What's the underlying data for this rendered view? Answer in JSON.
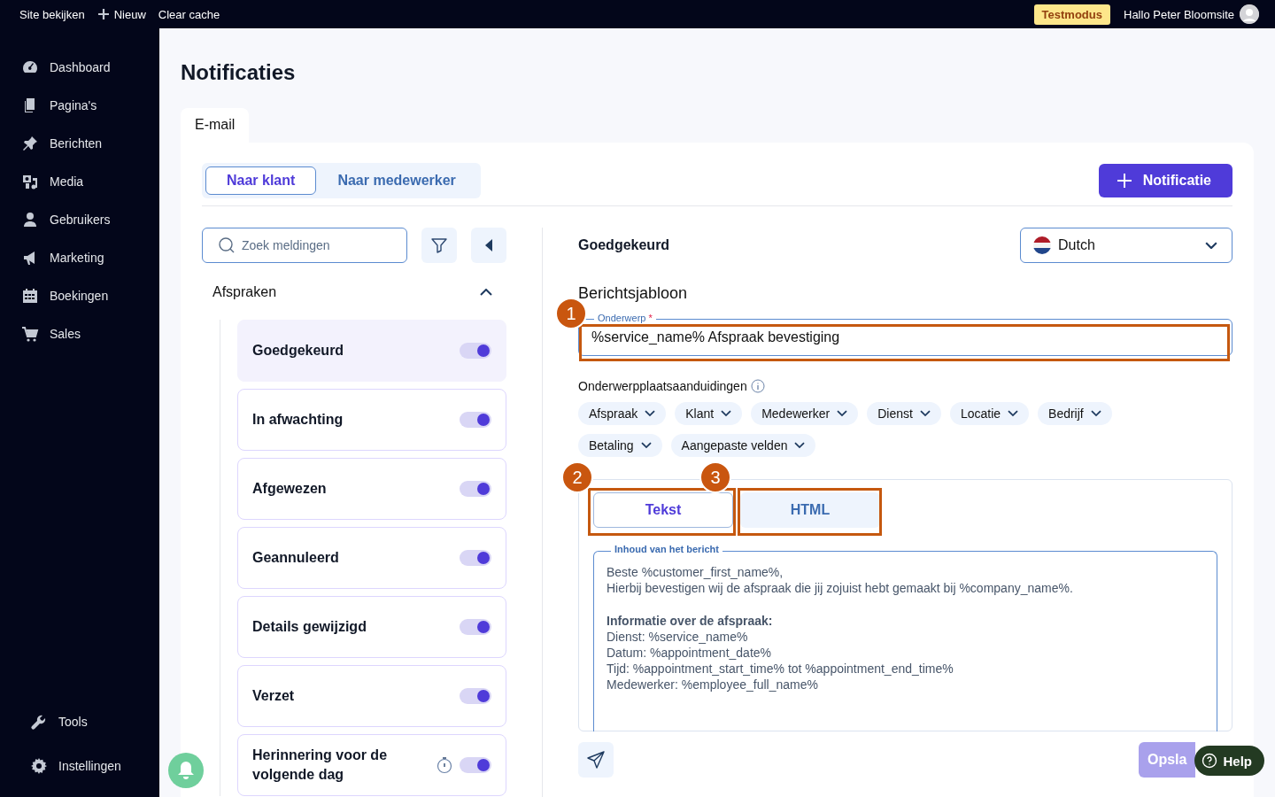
{
  "topbar": {
    "links": [
      "Site bekijken",
      "Nieuw",
      "Clear cache"
    ],
    "badge": "Testmodus",
    "greeting": "Hallo Peter Bloomsite"
  },
  "sidebar": {
    "items": [
      "Dashboard",
      "Pagina's",
      "Berichten",
      "Media",
      "Gebruikers",
      "Marketing",
      "Boekingen",
      "Sales"
    ],
    "bottom_items": [
      "Tools",
      "Instellingen"
    ]
  },
  "page_title": "Notificaties",
  "tabs": [
    {
      "label": "E-mail",
      "selected": true
    }
  ],
  "audience": [
    {
      "label": "Naar klant",
      "selected": true
    },
    {
      "label": "Naar medewerker",
      "selected": false
    }
  ],
  "add_button": "Notificatie",
  "search": {
    "placeholder": "Zoek meldingen"
  },
  "group": {
    "title": "Afspraken",
    "expanded": true,
    "items": [
      {
        "label": "Goedgekeurd",
        "on": true,
        "selected": true,
        "timer": false
      },
      {
        "label": "In afwachting",
        "on": true,
        "selected": false,
        "timer": false
      },
      {
        "label": "Afgewezen",
        "on": true,
        "selected": false,
        "timer": false
      },
      {
        "label": "Geannuleerd",
        "on": true,
        "selected": false,
        "timer": false
      },
      {
        "label": "Details gewijzigd",
        "on": true,
        "selected": false,
        "timer": false
      },
      {
        "label": "Verzet",
        "on": true,
        "selected": false,
        "timer": false
      },
      {
        "label": "Herinnering voor de volgende dag",
        "on": true,
        "selected": false,
        "timer": true
      }
    ]
  },
  "detail": {
    "title": "Goedgekeurd",
    "language": "Dutch",
    "section": "Berichtsjabloon",
    "subject": {
      "label": "Onderwerp",
      "required_mark": "*",
      "value": "%service_name% Afspraak bevestiging",
      "annotation": "1"
    },
    "placeholders_label": "Onderwerpplaatsaanduidingen",
    "chips": [
      "Afspraak",
      "Klant",
      "Medewerker",
      "Dienst",
      "Locatie",
      "Bedrijf",
      "Betaling",
      "Aangepaste velden"
    ],
    "editor_tabs": [
      {
        "label": "Tekst",
        "selected": true,
        "annotation": "2"
      },
      {
        "label": "HTML",
        "selected": false,
        "annotation": "3"
      }
    ],
    "body_label": "Inhoud van het bericht",
    "body": "Beste %customer_first_name%,\nHierbij bevestigen wij de afspraak die jij zojuist hebt gemaakt bij %company_name%.\n\n**Informatie over de afspraak:**\nDienst: %service_name%\nDatum: %appointment_date%\nTijd: %appointment_start_time% tot %appointment_end_time%\nMedewerker: %employee_full_name%",
    "save_button": "Opsla"
  },
  "help_button": "Help"
}
